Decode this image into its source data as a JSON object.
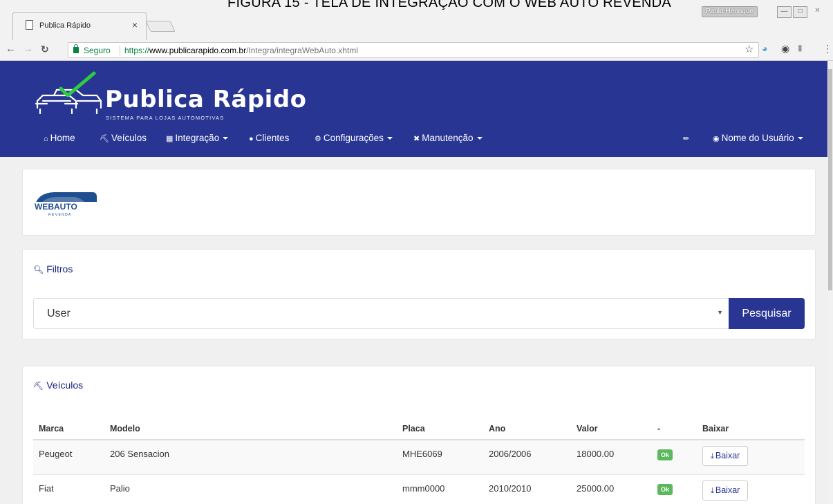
{
  "caption": "FIGURA 15 - TELA DE INTEGRAÇÃO COM O WEB AUTO REVENDA",
  "browser": {
    "tab_title": "Publica Rápido",
    "tab_close": "×",
    "user_name": "Paulo Henrique",
    "secure_label": "Seguro",
    "url_scheme": "https://",
    "url_host": "www.publicarapido.com.br",
    "url_path": "/Integra/integraWebAuto.xhtml"
  },
  "header": {
    "brand_title": "Publica Rápido",
    "brand_subtitle": "SISTEMA PARA LOJAS AUTOMOTIVAS",
    "nav": {
      "home": "Home",
      "veiculos": "Veículos",
      "integracao": "Integração",
      "clientes": "Clientes",
      "configuracoes": "Configurações",
      "manutencao": "Manutenção",
      "usuario": "Nome do Usuário"
    },
    "colors": {
      "primary": "#283593",
      "check": "#2ecc40"
    }
  },
  "logo_card": {
    "logo_text": "WEBAUTO",
    "logo_sub": "R E V E N D A"
  },
  "filter": {
    "title": "Filtros",
    "select_value": "User",
    "search_button": "Pesquisar"
  },
  "vehicles": {
    "title": "Veículos",
    "columns": [
      "Marca",
      "Modelo",
      "Placa",
      "Ano",
      "Valor",
      "-",
      "Baixar"
    ],
    "rows": [
      {
        "marca": "Peugeot",
        "modelo": "206 Sensacion",
        "placa": "MHE6069",
        "ano": "2006/2006",
        "valor": "18000.00",
        "status": "Ok",
        "action": "Baixar"
      },
      {
        "marca": "Fiat",
        "modelo": "Palio",
        "placa": "mmm0000",
        "ano": "2010/2010",
        "valor": "25000.00",
        "status": "Ok",
        "action": "Baixar"
      }
    ]
  }
}
